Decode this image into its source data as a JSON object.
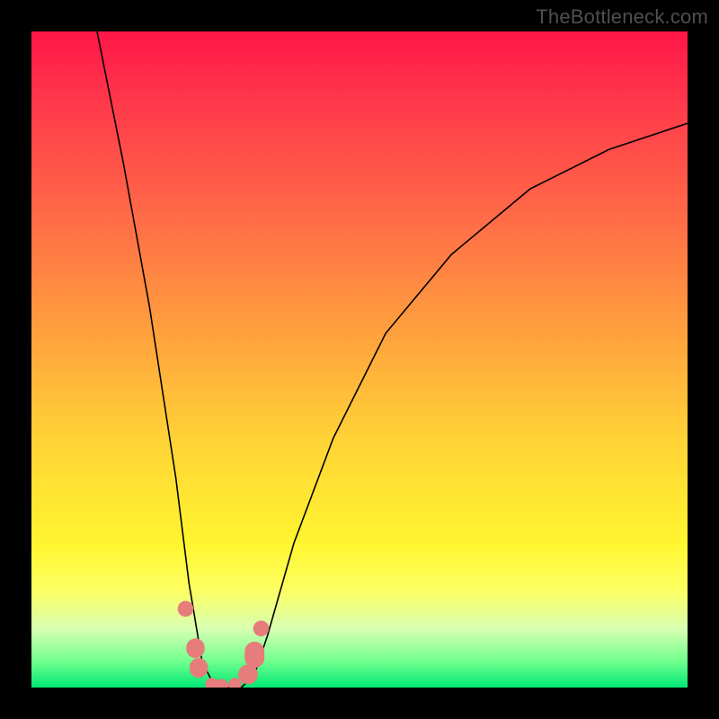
{
  "watermark": "TheBottleneck.com",
  "colors": {
    "frame_bg": "#000000",
    "gradient_top": "#ff1648",
    "gradient_bottom": "#00e874",
    "curve_stroke": "#000000",
    "marker": "#e77c7c",
    "watermark_text": "#4f4f4f"
  },
  "chart_data": {
    "type": "line",
    "title": "",
    "xlabel": "",
    "ylabel": "",
    "xlim": [
      0,
      100
    ],
    "ylim": [
      0,
      100
    ],
    "description": "V-shaped bottleneck curve. Y-axis reads as mismatch / bottleneck percentage (high at top = bad / red, low at bottom = good / green). X-axis implicitly reads as some hardware balance ratio. Curve descends steeply from top-left, reaches a flat minimum near x≈27–33 at y≈0–2, then rises with a concave decelerating climb toward upper right.",
    "series": [
      {
        "name": "bottleneck_curve",
        "x": [
          10,
          14,
          18,
          22,
          24,
          26,
          28,
          30,
          32,
          34,
          36,
          40,
          46,
          54,
          64,
          76,
          88,
          100
        ],
        "y": [
          100,
          80,
          58,
          32,
          16,
          4,
          0,
          0,
          0,
          2,
          8,
          22,
          38,
          54,
          66,
          76,
          82,
          86
        ]
      }
    ],
    "markers": [
      {
        "x": 23.5,
        "y": 12,
        "r": 1.2
      },
      {
        "x": 25.0,
        "y": 6,
        "r": 1.4,
        "shape": "pill",
        "h": 3
      },
      {
        "x": 25.5,
        "y": 3,
        "r": 1.4,
        "shape": "pill",
        "h": 3
      },
      {
        "x": 27.5,
        "y": 0.5,
        "r": 1.0
      },
      {
        "x": 29.0,
        "y": 0.3,
        "r": 1.0
      },
      {
        "x": 31.0,
        "y": 0.5,
        "r": 1.0
      },
      {
        "x": 33.0,
        "y": 2.0,
        "r": 1.5,
        "shape": "pill",
        "h": 3
      },
      {
        "x": 34.0,
        "y": 5.0,
        "r": 1.5,
        "shape": "pill",
        "h": 4
      },
      {
        "x": 35.0,
        "y": 9.0,
        "r": 1.2
      }
    ]
  }
}
